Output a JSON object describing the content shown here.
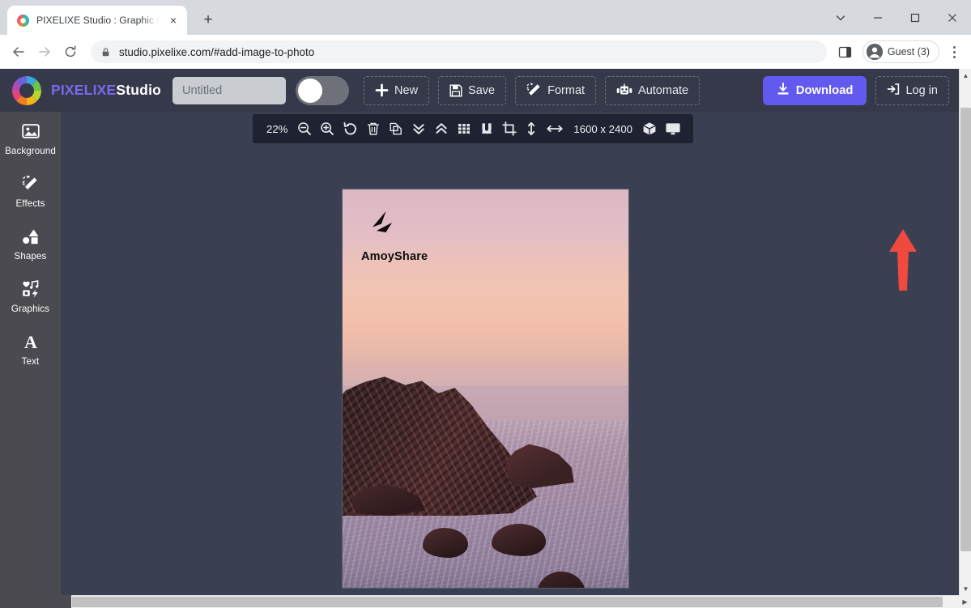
{
  "browser": {
    "tab": {
      "title": "PIXELIXE Studio : Graphic Crea",
      "favicon": "pixelixe-color-ring-icon",
      "close": "×"
    },
    "new_tab_label": "+",
    "window_controls": {
      "tab_search": "chevron-down-icon",
      "minimize": "minimize-icon",
      "maximize": "maximize-icon",
      "close": "close-icon"
    },
    "nav": {
      "back": "back-arrow-icon",
      "forward": "forward-arrow-icon",
      "reload": "reload-icon"
    },
    "omnibox": {
      "lock": "lock-icon",
      "url": "studio.pixelixe.com/#add-image-to-photo"
    },
    "side_panel": "side-panel-icon",
    "profile": {
      "label": "Guest (3)",
      "avatar": "person-avatar-icon"
    },
    "menu": "kebab-menu-icon"
  },
  "app": {
    "logo": {
      "pixelixe": "PIXELIXE",
      "studio": "Studio"
    },
    "title_field": {
      "value": "",
      "placeholder": "Untitled"
    },
    "toggle": {
      "state": "on"
    },
    "buttons": {
      "new": "New",
      "save": "Save",
      "format": "Format",
      "automate": "Automate",
      "download": "Download",
      "login": "Log in"
    },
    "accent_color": "#6259ef"
  },
  "sidebar": {
    "items": [
      {
        "label": "Background",
        "icon": "image-icon"
      },
      {
        "label": "Effects",
        "icon": "magic-wand-icon"
      },
      {
        "label": "Shapes",
        "icon": "shapes-icon"
      },
      {
        "label": "Graphics",
        "icon": "graphics-grid-icon"
      },
      {
        "label": "Text",
        "icon": "letter-a-icon"
      }
    ]
  },
  "canvas_toolbar": {
    "zoom_level": "22%",
    "dimensions": "1600 x 2400",
    "items": [
      {
        "name": "zoom-out-icon"
      },
      {
        "name": "zoom-in-icon"
      },
      {
        "name": "undo-icon"
      },
      {
        "name": "delete-icon"
      },
      {
        "name": "duplicate-icon"
      },
      {
        "name": "send-backward-icon"
      },
      {
        "name": "bring-forward-icon"
      },
      {
        "name": "grid-icon"
      },
      {
        "name": "magnet-snap-icon"
      },
      {
        "name": "crop-icon"
      },
      {
        "name": "resize-vertical-icon"
      },
      {
        "name": "resize-horizontal-icon"
      },
      {
        "name": "3d-box-icon"
      },
      {
        "name": "preview-monitor-icon"
      }
    ]
  },
  "canvas": {
    "watermark_text": "AmoyShare",
    "watermark_logo": "amoyshare-logo-icon",
    "image_description": "coastal cliff at pink sunset with ocean surf"
  },
  "annotation": {
    "arrow": "red-up-arrow-annotation",
    "color": "#f0493e"
  }
}
